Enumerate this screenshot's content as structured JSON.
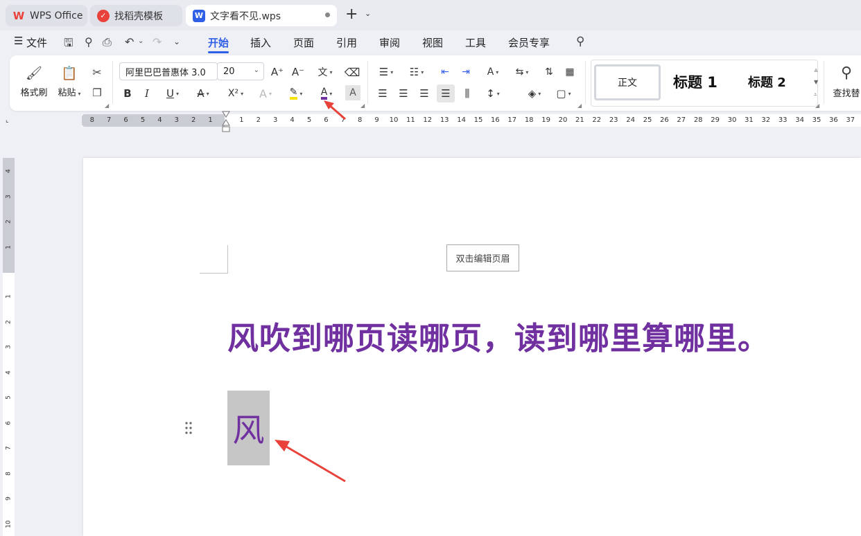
{
  "tabs": [
    {
      "label": "WPS Office",
      "icon": "wps-logo-icon"
    },
    {
      "label": "找稻壳模板",
      "icon": "docer-icon"
    },
    {
      "label": "文字看不见.wps",
      "icon": "writer-doc-icon"
    }
  ],
  "menu": {
    "file": "文件",
    "items": [
      "开始",
      "插入",
      "页面",
      "引用",
      "审阅",
      "视图",
      "工具",
      "会员专享"
    ]
  },
  "ribbon": {
    "format_painter": "格式刷",
    "paste": "粘贴",
    "font_name": "阿里巴巴普惠体 3.0",
    "font_size": "20",
    "style_normal": "正文",
    "style_h1": "标题 1",
    "style_h2": "标题 2",
    "find_replace": "查找替",
    "bold": "B",
    "italic": "I",
    "underline": "U",
    "superscript": "X²",
    "font_color_letter": "A",
    "char_shading": "A"
  },
  "ruler": {
    "left_ticks": [
      "8",
      "7",
      "6",
      "5",
      "4",
      "3",
      "2",
      "1"
    ],
    "right_ticks": [
      "1",
      "2",
      "3",
      "4",
      "5",
      "6",
      "7",
      "8",
      "9",
      "10",
      "11",
      "12",
      "13",
      "14",
      "15",
      "16",
      "17",
      "18",
      "19",
      "20",
      "21",
      "22",
      "23",
      "24",
      "25",
      "26",
      "27",
      "28",
      "29",
      "30",
      "31",
      "32",
      "33",
      "34",
      "35",
      "36",
      "37"
    ],
    "v_neg_ticks": [
      "4",
      "3",
      "2",
      "1"
    ],
    "v_pos_ticks": [
      "1",
      "2",
      "3",
      "4",
      "5",
      "6",
      "7",
      "8",
      "9",
      "10"
    ]
  },
  "document": {
    "header_hint": "双击编辑页眉",
    "headline": "风吹到哪页读哪页，读到哪里算哪里。",
    "selected_char": "风"
  },
  "colors": {
    "accent": "#2f5fe6",
    "text_purple": "#7030a0",
    "arrow_red": "#e8423a",
    "highlight_yellow": "#f5e30a"
  }
}
